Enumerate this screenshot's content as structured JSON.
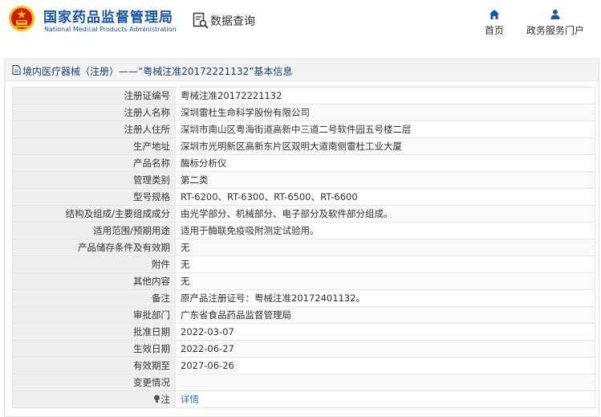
{
  "header": {
    "brand_cn": "国家药品监督管理局",
    "brand_en": "National Medical Products Administration",
    "db_title": "数据查询",
    "nav": [
      {
        "label": "首页",
        "icon": "home-icon"
      },
      {
        "label": "政务服务门户",
        "icon": "person-icon"
      }
    ]
  },
  "panel": {
    "title": "境内医疗器械（注册）——“粤械注准20172221132”基本信息"
  },
  "rows": [
    {
      "key": "注册证编号",
      "value": "粤械注准20172221132"
    },
    {
      "key": "注册人名称",
      "value": "深圳雷杜生命科学股份有限公司"
    },
    {
      "key": "注册人住所",
      "value": "深圳市南山区粤海街道高新中三道二号软件园五号楼二层"
    },
    {
      "key": "生产地址",
      "value": "深圳市光明新区高新东片区双明大道南侧雷杜工业大厦"
    },
    {
      "key": "产品名称",
      "value": "酶标分析仪"
    },
    {
      "key": "管理类别",
      "value": "第二类"
    },
    {
      "key": "型号规格",
      "value": "RT-6200、RT-6300、RT-6500、RT-6600"
    },
    {
      "key": "结构及组成/主要组成成分",
      "value": "由光学部分、机械部分、电子部分及软件部分组成。"
    },
    {
      "key": "适用范围/预期用途",
      "value": "适用于酶联免疫吸附测定试验用。"
    },
    {
      "key": "产品储存条件及有效期",
      "value": "无"
    },
    {
      "key": "附件",
      "value": "无"
    },
    {
      "key": "其他内容",
      "value": "无"
    },
    {
      "key": "备注",
      "value": "原产品注册证号：粤械注准20172401132。"
    },
    {
      "key": "审批部门",
      "value": "广东省食品药品监督管理局"
    },
    {
      "key": "批准日期",
      "value": "2022-03-07"
    },
    {
      "key": "生效日期",
      "value": "2022-06-27"
    },
    {
      "key": "有效期至",
      "value": "2027-06-26"
    },
    {
      "key": "变更情况",
      "value": ""
    },
    {
      "key": "注",
      "value": "详情"
    }
  ],
  "colors": {
    "brand_blue": "#1a56a8",
    "link_blue": "#2a6ebb",
    "logo_red": "#d7141a",
    "logo_gold": "#f2c200"
  }
}
